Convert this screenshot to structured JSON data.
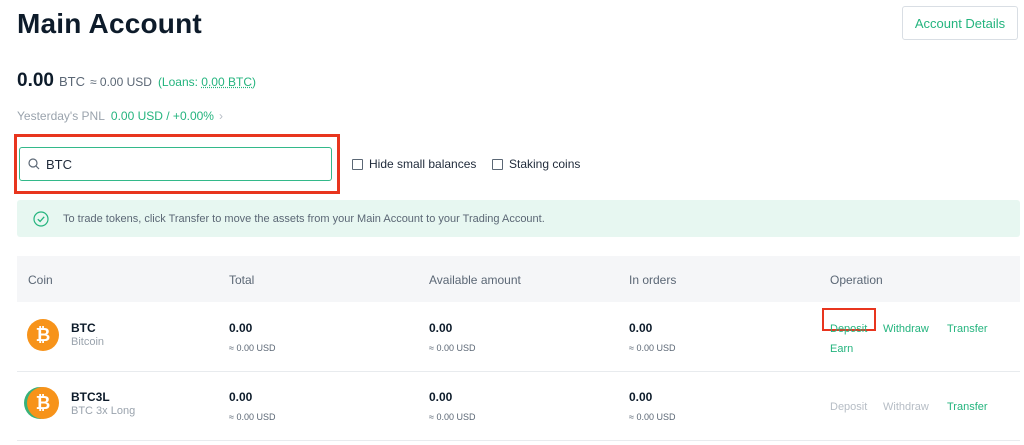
{
  "page_title": "Main Account",
  "account_details_label": "Account Details",
  "balance": {
    "amount": "0.00",
    "unit": "BTC",
    "usd": "≈ 0.00 USD",
    "loans_prefix": "(Loans: ",
    "loans_value": "0.00 BTC",
    "loans_suffix": ")"
  },
  "pnl": {
    "label": "Yesterday's PNL",
    "value": "0.00 USD / +0.00%",
    "chevron": "›"
  },
  "search": {
    "value": "BTC",
    "placeholder": ""
  },
  "filters": {
    "hide_small": "Hide small balances",
    "staking": "Staking coins"
  },
  "notice": "To trade tokens, click Transfer to move the assets from your Main Account to your Trading Account.",
  "table": {
    "headers": {
      "coin": "Coin",
      "total": "Total",
      "available": "Available amount",
      "in_orders": "In orders",
      "operation": "Operation"
    },
    "rows": [
      {
        "symbol": "BTC",
        "name": "Bitcoin",
        "total": "0.00",
        "total_usd": "≈ 0.00 USD",
        "available": "0.00",
        "available_usd": "≈ 0.00 USD",
        "in_orders": "0.00",
        "in_orders_usd": "≈ 0.00 USD",
        "ops": {
          "deposit": "Deposit",
          "withdraw": "Withdraw",
          "transfer": "Transfer",
          "earn": "Earn"
        }
      },
      {
        "symbol": "BTC3L",
        "name": "BTC 3x Long",
        "total": "0.00",
        "total_usd": "≈ 0.00 USD",
        "available": "0.00",
        "available_usd": "≈ 0.00 USD",
        "in_orders": "0.00",
        "in_orders_usd": "≈ 0.00 USD",
        "ops": {
          "deposit": "Deposit",
          "withdraw": "Withdraw",
          "transfer": "Transfer"
        }
      }
    ]
  },
  "icons": {
    "search": "search-icon",
    "check": "check-circle-icon",
    "coin": "bitcoin-icon"
  },
  "colors": {
    "accent": "#24b47e",
    "highlight": "#e8351e",
    "bitcoin": "#f7931a",
    "notice_bg": "#e7f7f1"
  }
}
